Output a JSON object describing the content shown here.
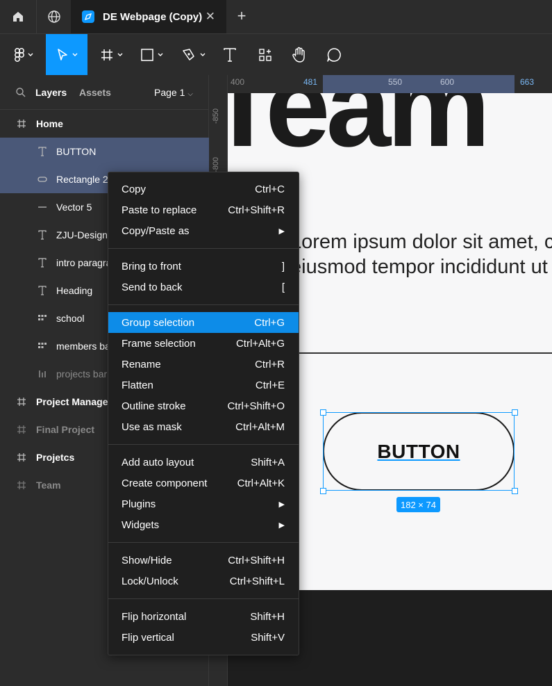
{
  "tabs": {
    "document_title": "DE Webpage (Copy)",
    "close_glyph": "✕",
    "add_glyph": "+"
  },
  "toolbar": {
    "active_tool": "move",
    "accent": "#0d99ff"
  },
  "left_panel": {
    "layers_tab": "Layers",
    "assets_tab": "Assets",
    "page_label": "Page 1",
    "layers": [
      {
        "name": "Home",
        "icon": "frame-icon",
        "level": "top",
        "selected": false,
        "dim": false
      },
      {
        "name": "BUTTON",
        "icon": "text-icon",
        "level": "child",
        "selected": true,
        "dim": false
      },
      {
        "name": "Rectangle 2",
        "icon": "ellipse-icon",
        "level": "child",
        "selected": true,
        "dim": false
      },
      {
        "name": "Vector 5",
        "icon": "line-icon",
        "level": "child",
        "selected": false,
        "dim": false
      },
      {
        "name": "ZJU-Design",
        "icon": "text-icon",
        "level": "child",
        "selected": false,
        "dim": false
      },
      {
        "name": "intro paragraph",
        "icon": "text-icon",
        "level": "child",
        "selected": false,
        "dim": false
      },
      {
        "name": "Heading",
        "icon": "text-icon",
        "level": "child",
        "selected": false,
        "dim": false
      },
      {
        "name": "school",
        "icon": "grid-icon",
        "level": "child",
        "selected": false,
        "dim": false
      },
      {
        "name": "members bar",
        "icon": "grid-icon",
        "level": "child",
        "selected": false,
        "dim": false
      },
      {
        "name": "projects bar",
        "icon": "bars-icon",
        "level": "child",
        "selected": false,
        "dim": true
      },
      {
        "name": "Project Management",
        "icon": "frame-icon",
        "level": "top",
        "selected": false,
        "dim": false
      },
      {
        "name": "Final Project",
        "icon": "frame-icon",
        "level": "top",
        "selected": false,
        "dim": true
      },
      {
        "name": "Projetcs",
        "icon": "frame-icon",
        "level": "top",
        "selected": false,
        "dim": false
      },
      {
        "name": "Team",
        "icon": "frame-icon",
        "level": "top",
        "selected": false,
        "dim": true
      }
    ]
  },
  "rulers": {
    "top": [
      "400",
      "481",
      "550",
      "600",
      "663"
    ],
    "left": [
      "-850",
      "-800"
    ]
  },
  "canvas": {
    "heading_text": "Team",
    "lorem_line1": "Lorem ipsum dolor sit amet, consectetur",
    "lorem_line2": "eiusmod tempor incididunt ut labore",
    "button_text": "BUTTON",
    "dimensions": "182 × 74"
  },
  "context_menu": {
    "groups": [
      [
        {
          "label": "Copy",
          "shortcut": "Ctrl+C",
          "submenu": false
        },
        {
          "label": "Paste to replace",
          "shortcut": "Ctrl+Shift+R",
          "submenu": false
        },
        {
          "label": "Copy/Paste as",
          "shortcut": "",
          "submenu": true
        }
      ],
      [
        {
          "label": "Bring to front",
          "shortcut": "]",
          "submenu": false
        },
        {
          "label": "Send to back",
          "shortcut": "[",
          "submenu": false
        }
      ],
      [
        {
          "label": "Group selection",
          "shortcut": "Ctrl+G",
          "submenu": false,
          "highlighted": true
        },
        {
          "label": "Frame selection",
          "shortcut": "Ctrl+Alt+G",
          "submenu": false
        },
        {
          "label": "Rename",
          "shortcut": "Ctrl+R",
          "submenu": false
        },
        {
          "label": "Flatten",
          "shortcut": "Ctrl+E",
          "submenu": false
        },
        {
          "label": "Outline stroke",
          "shortcut": "Ctrl+Shift+O",
          "submenu": false
        },
        {
          "label": "Use as mask",
          "shortcut": "Ctrl+Alt+M",
          "submenu": false
        }
      ],
      [
        {
          "label": "Add auto layout",
          "shortcut": "Shift+A",
          "submenu": false
        },
        {
          "label": "Create component",
          "shortcut": "Ctrl+Alt+K",
          "submenu": false
        },
        {
          "label": "Plugins",
          "shortcut": "",
          "submenu": true
        },
        {
          "label": "Widgets",
          "shortcut": "",
          "submenu": true
        }
      ],
      [
        {
          "label": "Show/Hide",
          "shortcut": "Ctrl+Shift+H",
          "submenu": false
        },
        {
          "label": "Lock/Unlock",
          "shortcut": "Ctrl+Shift+L",
          "submenu": false
        }
      ],
      [
        {
          "label": "Flip horizontal",
          "shortcut": "Shift+H",
          "submenu": false
        },
        {
          "label": "Flip vertical",
          "shortcut": "Shift+V",
          "submenu": false
        }
      ]
    ]
  }
}
